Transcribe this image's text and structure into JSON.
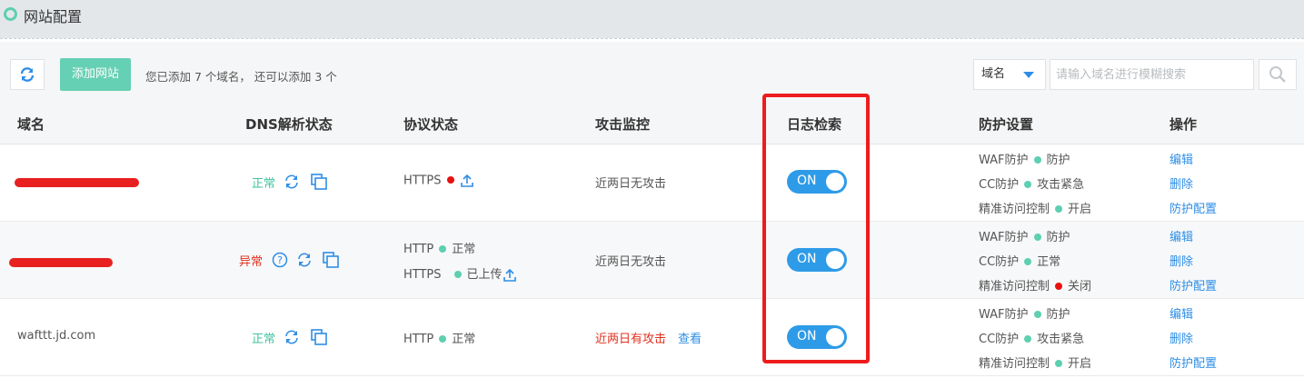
{
  "page": {
    "title": "网站配置"
  },
  "toolbar": {
    "add_label": "添加网站",
    "info": "您已添加 7 个域名， 还可以添加 3 个",
    "filter_value": "域名",
    "search_placeholder": "请输入域名进行模糊搜索"
  },
  "columns": [
    "域名",
    "DNS解析状态",
    "协议状态",
    "攻击监控",
    "日志检索",
    "防护设置",
    "操作"
  ],
  "rows": [
    {
      "domain": "",
      "dns_status": "正常",
      "protocols": [
        {
          "text": "HTTPS"
        }
      ],
      "attack": "近两日无攻击",
      "log_toggle": "ON",
      "protection": [
        {
          "name": "WAF防护",
          "value": "防护"
        },
        {
          "name": "CC防护",
          "value": "攻击紧急"
        },
        {
          "name": "精准访问控制",
          "value": "开启"
        }
      ],
      "actions": [
        "编辑",
        "删除",
        "防护配置"
      ]
    },
    {
      "domain": "",
      "dns_status": "异常",
      "protocols": [
        {
          "text": "HTTP",
          "status": "正常"
        },
        {
          "text": "HTTPS",
          "status": "已上传"
        }
      ],
      "attack": "近两日无攻击",
      "log_toggle": "ON",
      "protection": [
        {
          "name": "WAF防护",
          "value": "防护"
        },
        {
          "name": "CC防护",
          "value": "正常"
        },
        {
          "name": "精准访问控制",
          "value": "关闭"
        }
      ],
      "actions": [
        "编辑",
        "删除",
        "防护配置"
      ]
    },
    {
      "domain": "wafttt.jd.com",
      "dns_status": "正常",
      "protocols": [
        {
          "text": "HTTP",
          "status": "正常"
        }
      ],
      "attack": "近两日有攻击",
      "attack_link": "查看",
      "log_toggle": "ON",
      "protection": [
        {
          "name": "WAF防护",
          "value": "防护"
        },
        {
          "name": "CC防护",
          "value": "攻击紧急"
        },
        {
          "name": "精准访问控制",
          "value": "开启"
        }
      ],
      "actions": [
        "编辑",
        "删除",
        "防护配置"
      ]
    }
  ],
  "colors": {
    "accent": "#66d0b4",
    "link": "#2e8ee6",
    "error": "#e0301e",
    "toggle": "#2e9be8",
    "highlight": "#ee1c1c"
  }
}
